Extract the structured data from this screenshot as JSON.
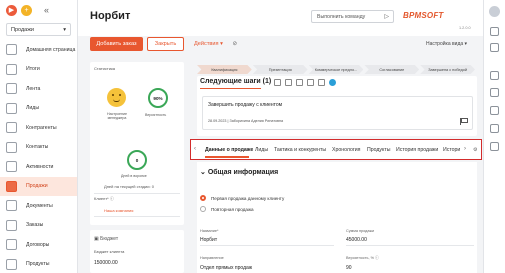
{
  "sidebar": {
    "workspace": "Продажи",
    "items": [
      {
        "label": "Домашняя страница",
        "icon": "home-icon"
      },
      {
        "label": "Итоги",
        "icon": "dashboard-icon"
      },
      {
        "label": "Лента",
        "icon": "feed-icon"
      },
      {
        "label": "Лиды",
        "icon": "leads-icon"
      },
      {
        "label": "Контрагенты",
        "icon": "accounts-icon"
      },
      {
        "label": "Контакты",
        "icon": "contacts-icon"
      },
      {
        "label": "Активности",
        "icon": "activities-icon"
      },
      {
        "label": "Продажи",
        "icon": "sales-icon",
        "active": true
      },
      {
        "label": "Документы",
        "icon": "documents-icon"
      },
      {
        "label": "Заказы",
        "icon": "orders-icon"
      },
      {
        "label": "Договоры",
        "icon": "contracts-icon"
      },
      {
        "label": "Продукты",
        "icon": "products-icon"
      }
    ]
  },
  "header": {
    "title": "Норбит",
    "command_placeholder": "Выполнить команду",
    "logo": "BPMSOFT",
    "version": "1.2.0.0"
  },
  "toolbar": {
    "add_order": "Добавить заказ",
    "close": "Закрыть",
    "actions": "Действия",
    "view_settings": "Настройка вида"
  },
  "stats": {
    "title": "Статистика",
    "mood_label": "Настроение менеджера",
    "probability": "90%",
    "probability_label": "Вероятность",
    "days": "0",
    "days_label": "Дней в воронке",
    "days_stage": "Дней на текущей стадии: 0",
    "client_label": "Клиент*",
    "client_value": "Наша компания"
  },
  "budget": {
    "title": "Бюджет",
    "label": "Бюджет клиента",
    "value": "150000.00"
  },
  "stages": [
    "Квалификация",
    "Презентация",
    "Коммерческое предло...",
    "Согласование",
    "Завершена с победой"
  ],
  "next_steps": {
    "title": "Следующие шаги (1)",
    "task_title": "Завершить продажу с клиентом",
    "task_meta": "28.09.2023 | Заборихина Аделия Ринатовна"
  },
  "tabs": [
    "Данные о продаже",
    "Лиды",
    "Тактика и конкуренты",
    "Хронология",
    "Продукты",
    "История продажи",
    "Истори"
  ],
  "general": {
    "title": "Общая информация",
    "radio_first": "Первая продажа данному клиенту",
    "radio_repeat": "Повторная продажа",
    "name_label": "Название*",
    "name_value": "Норбит",
    "amount_label": "Сумма продажи",
    "amount_value": "45000.00",
    "direction_label": "Направление",
    "direction_value": "Отдел прямых продаж",
    "prob_label": "Вероятность, %",
    "prob_value": "90"
  }
}
